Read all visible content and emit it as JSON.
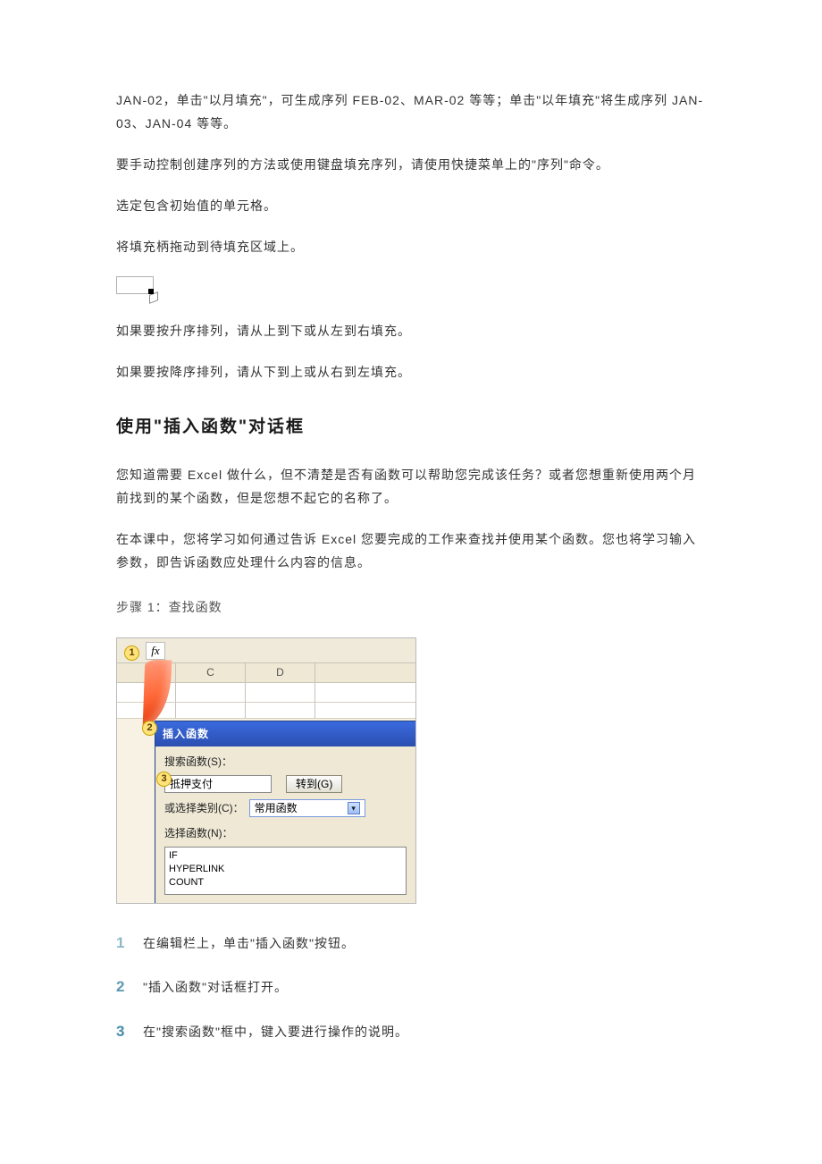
{
  "paragraphs": {
    "p1": "JAN-02，单击\"以月填充\"，可生成序列 FEB-02、MAR-02 等等；单击\"以年填充\"将生成序列 JAN-03、JAN-04 等等。",
    "p2": "要手动控制创建序列的方法或使用键盘填充序列，请使用快捷菜单上的\"序列\"命令。",
    "p3": "选定包含初始值的单元格。",
    "p4": "将填充柄拖动到待填充区域上。",
    "p5": "如果要按升序排列，请从上到下或从左到右填充。",
    "p6": "如果要按降序排列，请从下到上或从右到左填充。"
  },
  "section": {
    "heading": "使用\"插入函数\"对话框",
    "intro1": "您知道需要 Excel 做什么，但不清楚是否有函数可以帮助您完成该任务？或者您想重新使用两个月前找到的某个函数，但是您想不起它的名称了。",
    "intro2": "在本课中，您将学习如何通过告诉 Excel 您要完成的工作来查找并使用某个函数。您也将学习输入参数，即告诉函数应处理什么内容的信息。"
  },
  "step": {
    "caption": "步骤 1：查找函数"
  },
  "illus": {
    "callout1": "1",
    "callout2": "2",
    "callout3": "3",
    "fx_label": "fx",
    "colC": "C",
    "colD": "D",
    "dlg_title": "插入函数",
    "search_label": "搜索函数(S)：",
    "search_value": "抵押支付",
    "go_btn": "转到(G)",
    "category_label": "或选择类别(C)：",
    "category_value": "常用函数",
    "select_fn_label": "选择函数(N)：",
    "fn1": "IF",
    "fn2": "HYPERLINK",
    "fn3": "COUNT"
  },
  "instructions": {
    "i1_num": "1",
    "i1": "在编辑栏上，单击\"插入函数\"按钮。",
    "i2_num": "2",
    "i2": "\"插入函数\"对话框打开。",
    "i3_num": "3",
    "i3": " 在\"搜索函数\"框中，键入要进行操作的说明。"
  }
}
